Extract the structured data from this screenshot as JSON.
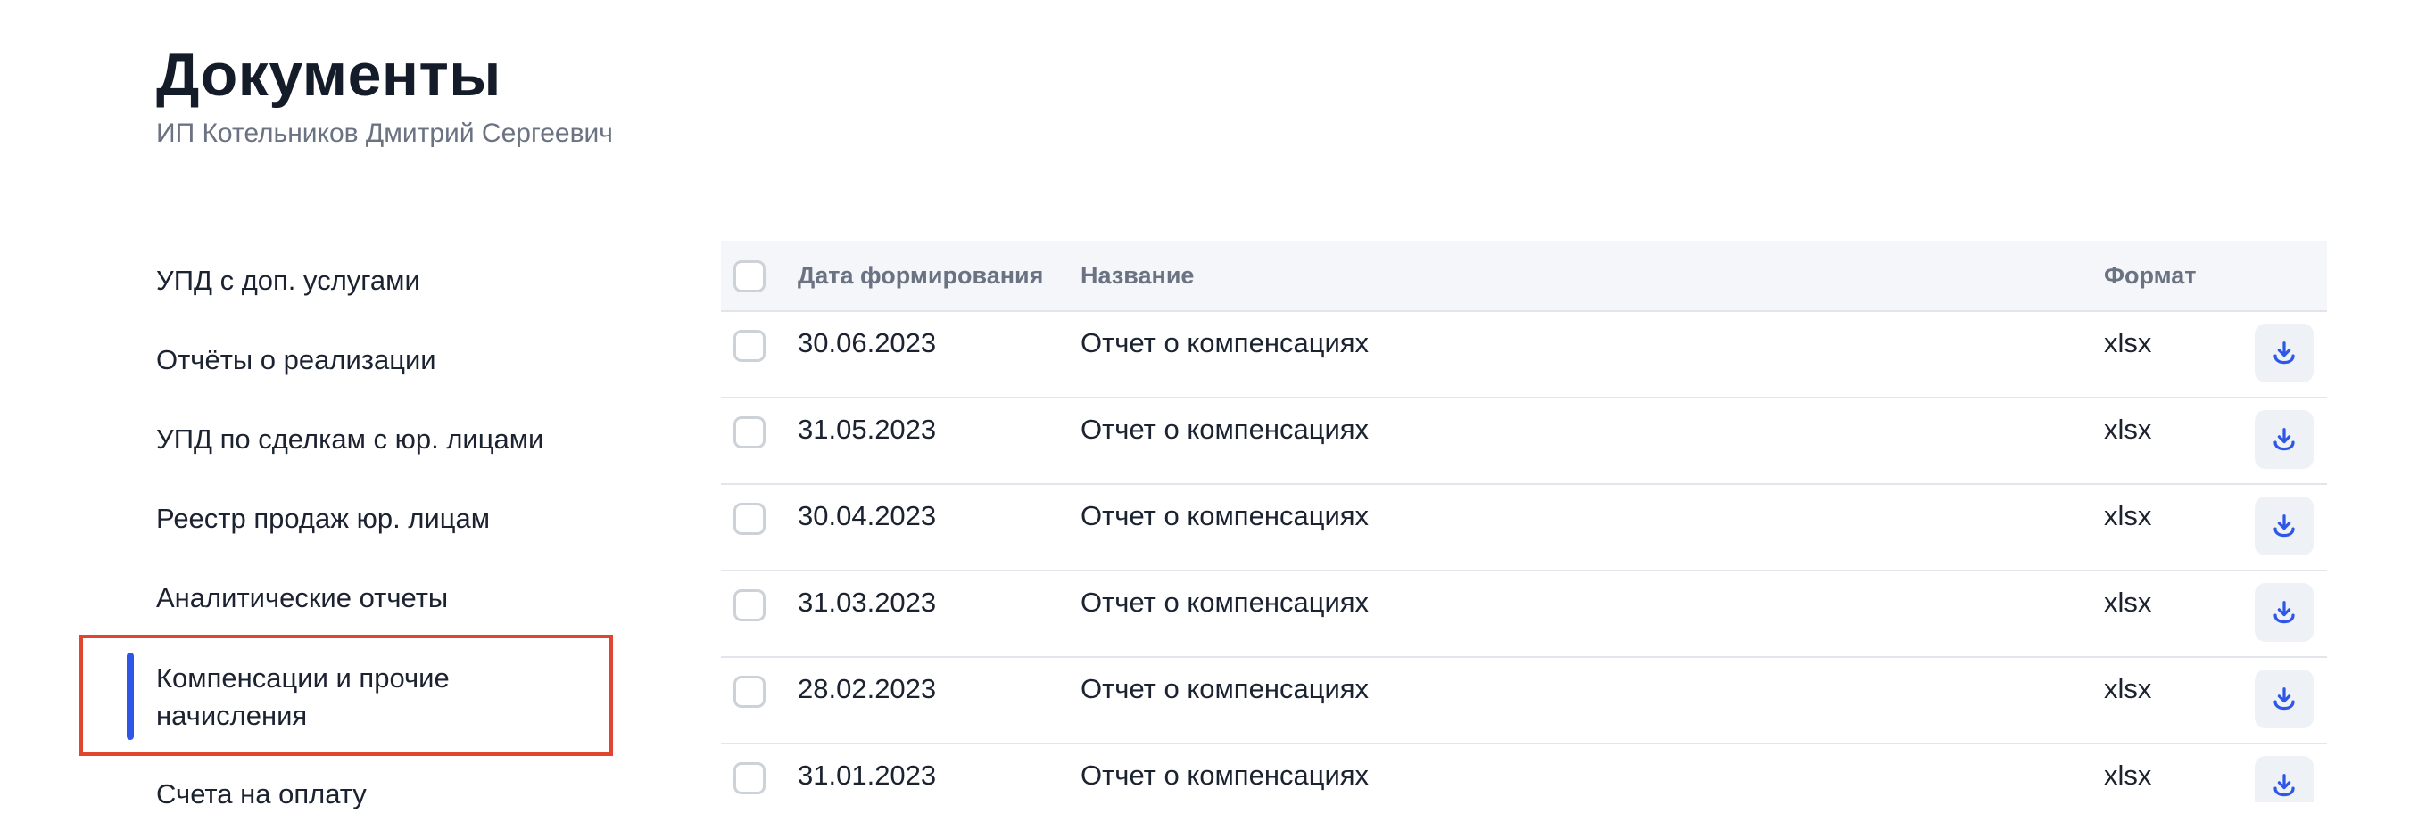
{
  "page": {
    "title": "Документы",
    "subtitle": "ИП Котельников Дмитрий Сергеевич"
  },
  "sidebar": {
    "items": [
      {
        "label": "УПД с доп. услугами",
        "active": false
      },
      {
        "label": "Отчёты о реализации",
        "active": false
      },
      {
        "label": "УПД по сделкам с юр. лицами",
        "active": false
      },
      {
        "label": "Реестр продаж юр. лицам",
        "active": false
      },
      {
        "label": "Аналитические отчеты",
        "active": false
      },
      {
        "label": "Компенсации и прочие начисления",
        "active": true
      },
      {
        "label": "Счета на оплату",
        "active": false
      }
    ]
  },
  "table": {
    "columns": {
      "date": "Дата формирования",
      "name": "Название",
      "format": "Формат"
    },
    "rows": [
      {
        "date": "30.06.2023",
        "name": "Отчет о компенсациях",
        "format": "xlsx"
      },
      {
        "date": "31.05.2023",
        "name": "Отчет о компенсациях",
        "format": "xlsx"
      },
      {
        "date": "30.04.2023",
        "name": "Отчет о компенсациях",
        "format": "xlsx"
      },
      {
        "date": "31.03.2023",
        "name": "Отчет о компенсациях",
        "format": "xlsx"
      },
      {
        "date": "28.02.2023",
        "name": "Отчет о компенсациях",
        "format": "xlsx"
      },
      {
        "date": "31.01.2023",
        "name": "Отчет о компенсациях",
        "format": "xlsx"
      }
    ]
  },
  "icons": {
    "download": "download-icon"
  },
  "colors": {
    "accent": "#2e57e8",
    "highlight": "#e2452f",
    "header_bg": "#f4f6fa",
    "button_bg": "#eef1f6"
  }
}
